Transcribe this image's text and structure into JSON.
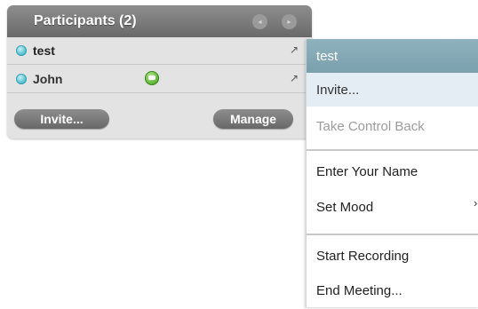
{
  "panel": {
    "title": "Participants (2)",
    "nav_prev_icon": "◂",
    "nav_next_icon": "▸",
    "participants": [
      {
        "name": "test",
        "status_icon": "status-dot-icon",
        "pin_icon": "↗"
      },
      {
        "name": "John",
        "status_icon": "status-dot-icon",
        "chat_icon": "chat-bubble-icon",
        "pin_icon": "↗"
      }
    ],
    "invite_label": "Invite...",
    "manage_label": "Manage"
  },
  "menu": {
    "title": "test",
    "items": [
      {
        "label": "Invite...",
        "state": "highlighted"
      },
      {
        "label": "Take Control Back",
        "state": "disabled"
      },
      {
        "label": "Enter Your Name"
      },
      {
        "label": "Set Mood",
        "submenu_arrow": "›"
      },
      {
        "label": "Start Recording"
      },
      {
        "label": "End Meeting..."
      }
    ]
  },
  "colors": {
    "header": "#7b7b7b",
    "menu_title": "#86aab6",
    "menu_highlight": "#e4ecf4",
    "status_dot": "#3fb6c8",
    "chat_green": "#4fa82a"
  }
}
